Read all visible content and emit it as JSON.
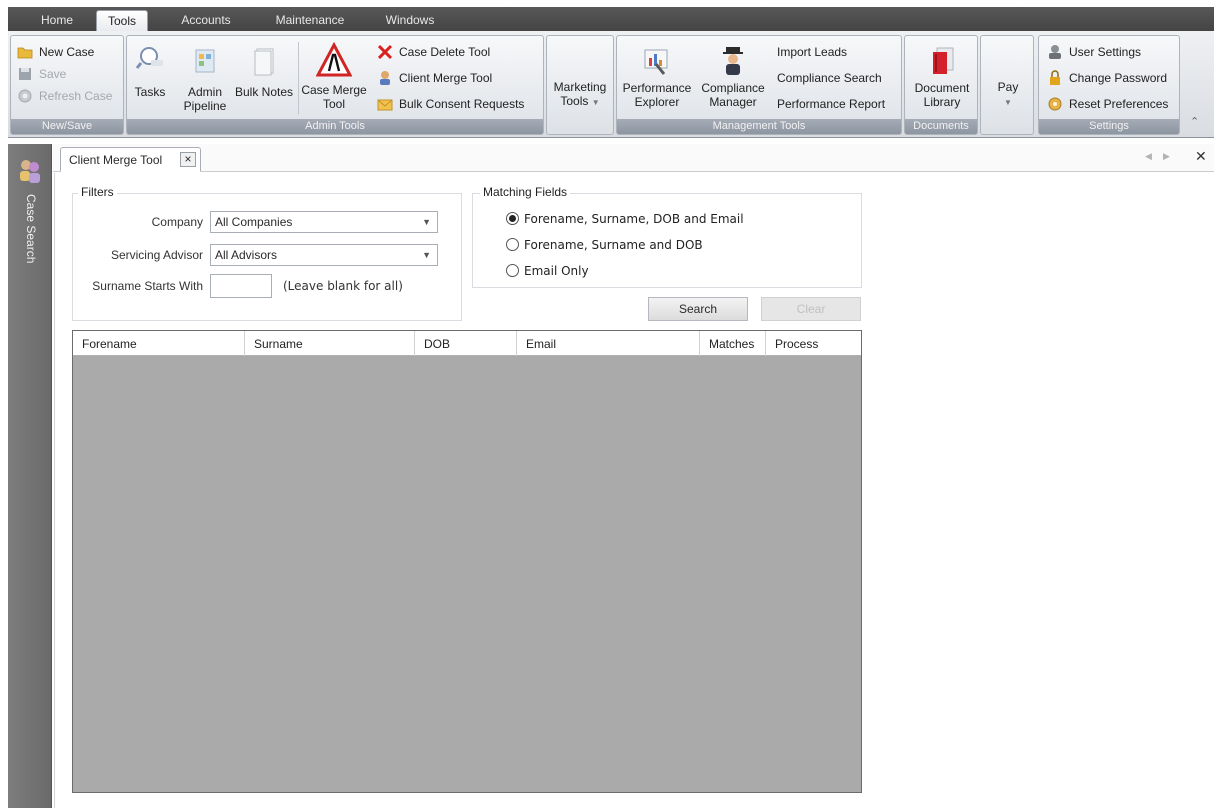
{
  "ribbon_tabs": [
    {
      "label": "Home"
    },
    {
      "label": "Tools"
    },
    {
      "label": "Accounts"
    },
    {
      "label": "Maintenance"
    },
    {
      "label": "Windows"
    }
  ],
  "active_tab": "Tools",
  "groups": {
    "new_save": {
      "caption": "New/Save",
      "new_case": "New Case",
      "save": "Save",
      "refresh_case": "Refresh Case"
    },
    "admin_tools": {
      "caption": "Admin Tools",
      "tasks": "Tasks",
      "admin_pipeline_1": "Admin",
      "admin_pipeline_2": "Pipeline",
      "bulk_notes": "Bulk Notes",
      "case_merge_1": "Case Merge",
      "case_merge_2": "Tool",
      "case_delete_tool": "Case Delete Tool",
      "client_merge_tool": "Client Merge Tool",
      "bulk_consent_requests": "Bulk Consent Requests"
    },
    "marketing": {
      "label_1": "Marketing",
      "label_2": "Tools"
    },
    "management_tools": {
      "caption": "Management Tools",
      "perf_explorer_1": "Performance",
      "perf_explorer_2": "Explorer",
      "compliance_manager_1": "Compliance",
      "compliance_manager_2": "Manager",
      "import_leads": "Import Leads",
      "compliance_search": "Compliance Search",
      "performance_report": "Performance Report"
    },
    "documents": {
      "caption": "Documents",
      "doc_library_1": "Document",
      "doc_library_2": "Library"
    },
    "pay": {
      "label": "Pay"
    },
    "settings": {
      "caption": "Settings",
      "user_settings": "User Settings",
      "change_password": "Change Password",
      "reset_preferences": "Reset Preferences"
    }
  },
  "sidebar": {
    "label": "Case Search"
  },
  "doc_tab": {
    "label": "Client Merge Tool",
    "close": "×"
  },
  "filters": {
    "legend": "Filters",
    "company_label": "Company",
    "company_value": "All Companies",
    "advisor_label": "Servicing Advisor",
    "advisor_value": "All Advisors",
    "surname_label": "Surname Starts With",
    "surname_value": "",
    "surname_hint": "(Leave blank for all)"
  },
  "matching": {
    "legend": "Matching Fields",
    "options": [
      {
        "label": "Forename, Surname, DOB and Email",
        "checked": true
      },
      {
        "label": "Forename, Surname and DOB",
        "checked": false
      },
      {
        "label": "Email Only",
        "checked": false
      }
    ]
  },
  "buttons": {
    "search": "Search",
    "clear": "Clear"
  },
  "grid": {
    "columns": [
      "Forename",
      "Surname",
      "DOB",
      "Email",
      "Matches",
      "Process"
    ],
    "rows": []
  },
  "colors": {
    "tabstrip": "#4e4e4e",
    "group_caption": "#949ca7",
    "grid_background": "#aaaaaa",
    "sidebar": "#747474"
  }
}
